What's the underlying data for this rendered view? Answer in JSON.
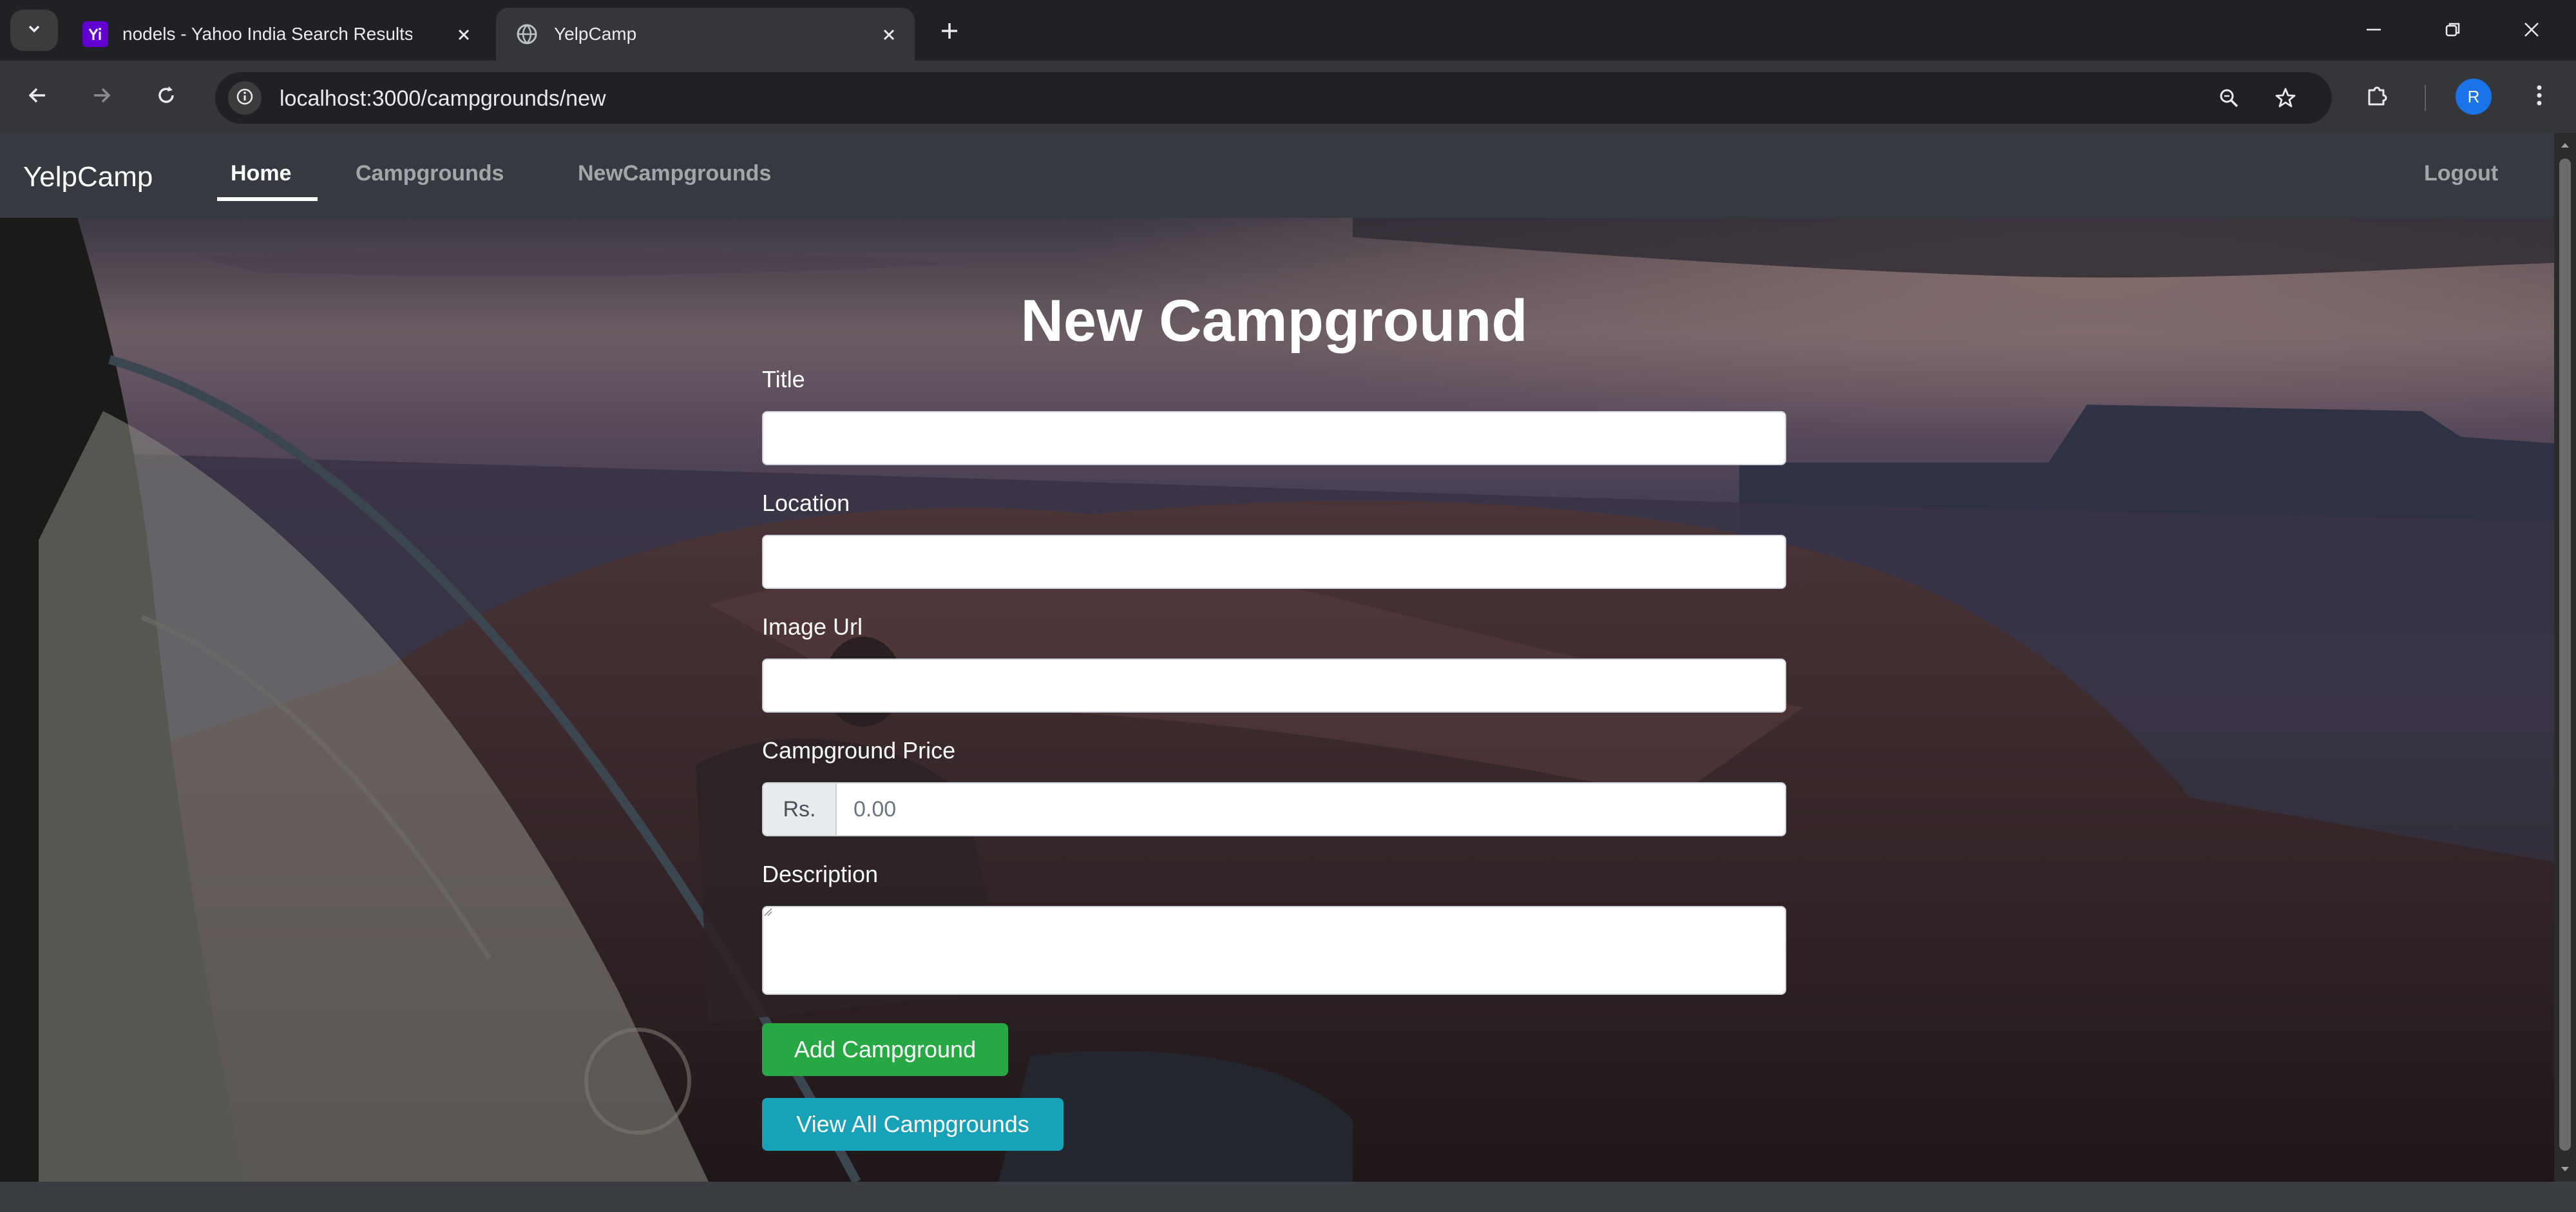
{
  "browser": {
    "tabs": [
      {
        "title": "nodels - Yahoo India Search Results",
        "favicon": "yahoo-favicon",
        "active": false
      },
      {
        "title": "YelpCamp",
        "favicon": "globe-icon",
        "active": true
      }
    ],
    "url": "localhost:3000/campgrounds/new",
    "profile_initial": "R"
  },
  "navbar": {
    "brand": "YelpCamp",
    "links": [
      {
        "label": "Home",
        "active": true
      },
      {
        "label": "Campgrounds",
        "active": false
      },
      {
        "label": "NewCampgrounds",
        "active": false
      }
    ],
    "logout": "Logout"
  },
  "form": {
    "heading": "New Campground",
    "title_label": "Title",
    "title_value": "",
    "location_label": "Location",
    "location_value": "",
    "image_label": "Image Url",
    "image_value": "",
    "price_label": "Campground Price",
    "price_addon": "Rs.",
    "price_placeholder": "0.00",
    "description_label": "Description",
    "description_value": "",
    "submit_label": "Add Campground",
    "view_all_label": "View All Campgrounds"
  },
  "colors": {
    "navbar": "#343a40",
    "success": "#28a745",
    "info": "#17a2b8",
    "chrome_bg": "#202124",
    "chrome_toolbar": "#35363a"
  }
}
